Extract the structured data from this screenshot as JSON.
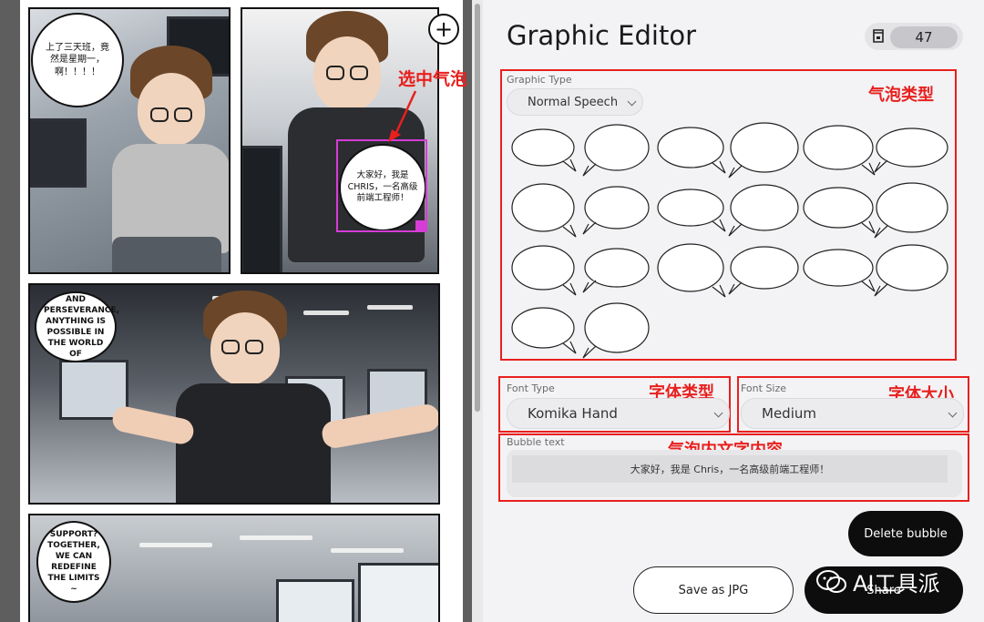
{
  "canvas": {
    "add_panel_label": "+",
    "bubbles": [
      {
        "text": "上了三天班，竟然是星期一，啊！！！！"
      },
      {
        "text": "大家好，我是 CHRIS，一名高级前端工程师！"
      },
      {
        "text": "AND PERSEVERANCE, ANYTHING IS POSSIBLE IN THE WORLD OF"
      },
      {
        "text": "SUPPORT? TOGETHER, WE CAN REDEFINE THE LIMITS ~"
      }
    ],
    "annotation_selected": "选中气泡"
  },
  "editor": {
    "title": "Graphic Editor",
    "credits": "47",
    "graphic_type": {
      "label": "Graphic Type",
      "value": "Normal Speech",
      "annotation": "气泡类型",
      "bubble_count": 20
    },
    "font_type": {
      "label": "Font Type",
      "value": "Komika Hand",
      "annotation": "字体类型"
    },
    "font_size": {
      "label": "Font Size",
      "value": "Medium",
      "annotation": "字体大小"
    },
    "bubble_text": {
      "label": "Bubble text",
      "value": "大家好，我是 Chris，一名高级前端工程师！",
      "annotation": "气泡内文字内容"
    },
    "buttons": {
      "delete": "Delete bubble",
      "save": "Save as JPG",
      "share": "Share"
    },
    "watermark": "AI工具派"
  },
  "colors": {
    "accent_annotation": "#e8201e",
    "selection": "#d63cd6",
    "primary_button": "#0d0d0d"
  }
}
